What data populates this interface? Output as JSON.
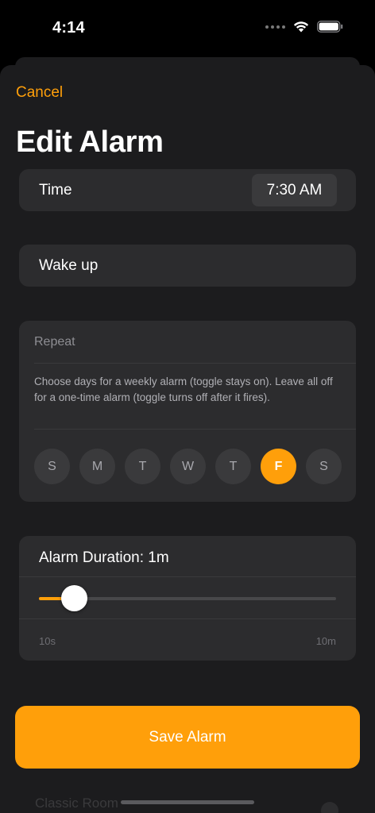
{
  "status_bar": {
    "time": "4:14"
  },
  "sheet": {
    "cancel_label": "Cancel",
    "title": "Edit Alarm"
  },
  "time_row": {
    "label": "Time",
    "value": "7:30 AM"
  },
  "name_row": {
    "value": "Wake up"
  },
  "repeat": {
    "header": "Repeat",
    "help": "Choose days for a weekly alarm (toggle stays on). Leave all off for a one-time alarm (toggle turns off after it fires).",
    "days": [
      {
        "label": "S",
        "selected": false
      },
      {
        "label": "M",
        "selected": false
      },
      {
        "label": "T",
        "selected": false
      },
      {
        "label": "W",
        "selected": false
      },
      {
        "label": "T",
        "selected": false
      },
      {
        "label": "F",
        "selected": true
      },
      {
        "label": "S",
        "selected": false
      }
    ]
  },
  "duration": {
    "label": "Alarm Duration: 1m",
    "min_label": "10s",
    "max_label": "10m",
    "fraction": 0.118
  },
  "save_label": "Save Alarm",
  "underlying": {
    "text": "Classic Room"
  },
  "colors": {
    "accent": "#ff9f0a",
    "card": "#2c2c2e",
    "sheet": "#1c1c1e"
  }
}
